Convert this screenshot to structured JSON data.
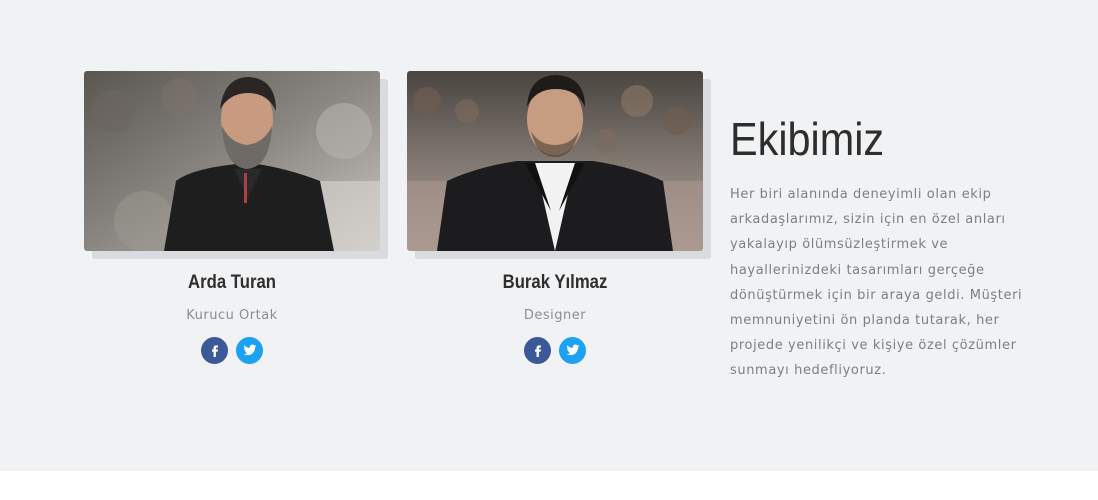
{
  "team": {
    "members": [
      {
        "name": "Arda Turan",
        "role": "Kurucu Ortak",
        "photo_icon": "person-photo-bearded-man-black-polo",
        "social": {
          "facebook_icon": "facebook-icon",
          "twitter_icon": "twitter-icon"
        }
      },
      {
        "name": "Burak Yılmaz",
        "role": "Designer",
        "photo_icon": "person-photo-man-dark-blazer",
        "social": {
          "facebook_icon": "facebook-icon",
          "twitter_icon": "twitter-icon"
        }
      }
    ]
  },
  "about": {
    "title": "Ekibimiz",
    "text": "Her biri alanında deneyimli olan ekip arkadaşlarımız, sizin için en özel anları yakalayıp ölümsüzleştirmek ve hayallerinizdeki tasarımları gerçeğe dönüştürmek için bir araya geldi. Müşteri memnuniyetini ön planda tutarak, her projede yenilikçi ve kişiye özel çözümler sunmayı hedefliyoruz."
  },
  "colors": {
    "section_bg": "#f1f2f4",
    "facebook": "#3b5998",
    "twitter": "#1da1f2",
    "heading": "#2d2d2d",
    "text": "#7b7f86"
  }
}
